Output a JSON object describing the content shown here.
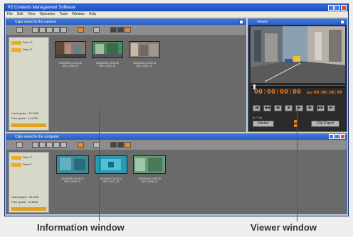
{
  "app": {
    "title": "P2 Contents Management Software",
    "menu": [
      "File",
      "Edit",
      "View",
      "Operation",
      "Tools",
      "Window",
      "Help"
    ]
  },
  "top_panel": {
    "title": "Clips saved to the camera",
    "sidebar": {
      "drives": [
        "Drive D:",
        "Drive E:"
      ],
      "used_label": "Used space : 12.3GB",
      "free_label": "Free space : 19.4GB"
    },
    "clips": [
      {
        "caption_line1": "2010/09/10 10:21:43",
        "caption_line2": "0001_0009_01"
      },
      {
        "caption_line1": "2010/09/10 10:23:02",
        "caption_line2": "0001_0010_01"
      },
      {
        "caption_line1": "2010/09/10 10:24:15",
        "caption_line2": "0001_0011_01"
      }
    ]
  },
  "bottom_panel": {
    "title": "Clips saved to the computer",
    "sidebar": {
      "drives": [
        "Drive C:",
        "Drive F:"
      ],
      "used_label": "Used space : 45.1GB",
      "free_label": "Free space : 33.8GB"
    },
    "clips": [
      {
        "caption_line1": "2010/09/10 09:58:21",
        "caption_line2": "0001_0006_01"
      },
      {
        "caption_line1": "2010/09/10 10:02:47",
        "caption_line2": "0001_0007_01"
      },
      {
        "caption_line1": "2010/09/10 10:05:36",
        "caption_line2": "0001_0008_01"
      }
    ]
  },
  "viewer": {
    "title": "Viewer",
    "timecode_main": "00:00:00:00",
    "timecode_duration": "00:00:00:00",
    "duration_label": "Dur",
    "marker_label": "In / Out",
    "btn_left": "Marker",
    "btn_right": "Clip Export",
    "controls": [
      "|◀",
      "◀◀",
      "◀|",
      "■",
      "▶",
      "|▶",
      "▶▶",
      "▶|"
    ]
  },
  "labels": {
    "information_window": "Information window",
    "viewer_window": "Viewer window"
  }
}
